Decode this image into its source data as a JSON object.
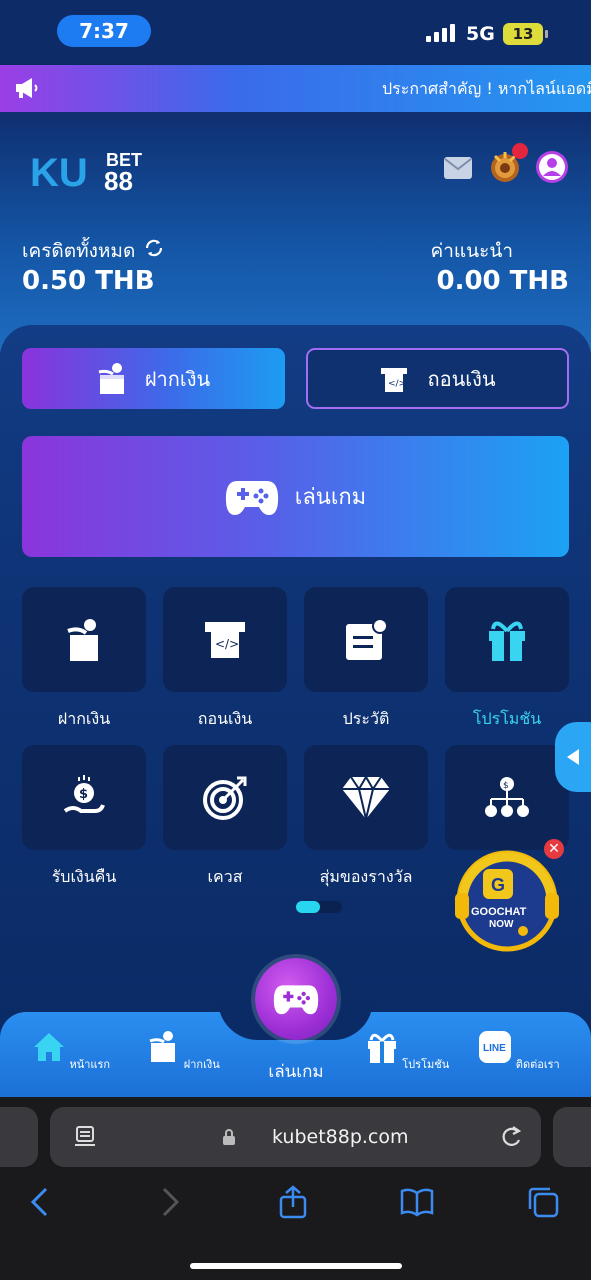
{
  "status_bar": {
    "time": "7:37",
    "network": "5G",
    "battery": "13"
  },
  "announcement": {
    "text": "ประกาศสำคัญ ! หากไลน์แอดมิ"
  },
  "header": {
    "logo_ku": "KU",
    "logo_bet": "BET",
    "logo_88": "88",
    "credit_label": "เครดิตทั้งหมด",
    "credit_value": "0.50 THB",
    "referral_label": "ค่าแนะนำ",
    "referral_value": "0.00 THB"
  },
  "actions": {
    "deposit": "ฝากเงิน",
    "withdraw": "ถอนเงิน",
    "play": "เล่นเกม"
  },
  "menu": {
    "items": [
      {
        "label": "ฝากเงิน",
        "icon": "deposit-icon"
      },
      {
        "label": "ถอนเงิน",
        "icon": "withdraw-icon"
      },
      {
        "label": "ประวัติ",
        "icon": "history-icon"
      },
      {
        "label": "โปรโมชัน",
        "icon": "gift-icon",
        "highlight": true
      },
      {
        "label": "รับเงินคืน",
        "icon": "cashback-icon"
      },
      {
        "label": "เควส",
        "icon": "target-icon"
      },
      {
        "label": "สุ่มของรางวัล",
        "icon": "diamond-icon"
      },
      {
        "label": "",
        "icon": "referral-tree-icon"
      }
    ],
    "highlight_color": "#39d4f2"
  },
  "goochat": {
    "line1": "GOOCHAT",
    "line2": "NOW"
  },
  "bottom_nav": {
    "items": [
      {
        "label": "หน้าแรก",
        "icon": "home-icon"
      },
      {
        "label": "ฝากเงิน",
        "icon": "deposit-icon"
      },
      {
        "label": "เล่นเกม",
        "icon": "gamepad-icon"
      },
      {
        "label": "โปรโมชัน",
        "icon": "gift-icon"
      },
      {
        "label": "ติดต่อเรา",
        "icon": "line-icon"
      }
    ],
    "line_badge": "LINE"
  },
  "browser": {
    "url": "kubet88p.com"
  },
  "colors": {
    "accent_purple": "#8a33dc",
    "accent_blue": "#1d9cf2",
    "panel": "#0e3273"
  }
}
